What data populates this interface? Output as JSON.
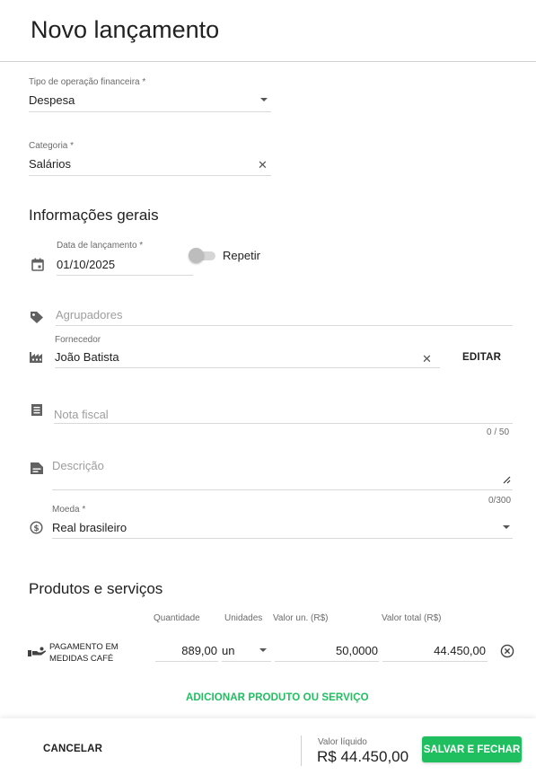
{
  "page": {
    "title": "Novo lançamento"
  },
  "operation": {
    "label": "Tipo de operação financeira *",
    "value": "Despesa"
  },
  "category": {
    "label": "Categoria *",
    "value": "Salários"
  },
  "general": {
    "heading": "Informações gerais",
    "date_label": "Data de lançamento *",
    "date_value": "01/10/2025",
    "repeat_label": "Repetir",
    "tags_placeholder": "Agrupadores",
    "supplier_label": "Fornecedor",
    "supplier_value": "João Batista",
    "edit_label": "EDITAR",
    "invoice_placeholder": "Nota fiscal",
    "invoice_counter": "0 / 50",
    "description_placeholder": "Descrição",
    "description_counter": "0/300",
    "currency_label": "Moeda *",
    "currency_value": "Real brasileiro"
  },
  "products": {
    "heading": "Produtos e serviços",
    "columns": {
      "quantity": "Quantidade",
      "units": "Unidades",
      "unit_value": "Valor un. (R$)",
      "total_value": "Valor total (R$)"
    },
    "rows": [
      {
        "name_line1": "PAGAMENTO EM",
        "name_line2": "MEDIDAS CAFÉ",
        "quantity": "889,00",
        "unit": "un",
        "unit_value": "50,0000",
        "total_value": "44.450,00"
      }
    ],
    "add_label": "ADICIONAR PRODUTO OU SERVIÇO"
  },
  "footer": {
    "cancel_label": "CANCELAR",
    "net_label": "Valor líquido",
    "net_value": "R$ 44.450,00",
    "save_label": "SALVAR E FECHAR"
  },
  "colors": {
    "accent": "#1fbf5f",
    "text": "#212121",
    "muted": "#6b6b6b"
  },
  "icons": [
    "calendar-icon",
    "tag-icon",
    "factory-icon",
    "receipt-icon",
    "description-icon",
    "currency-icon",
    "hand-coin-icon",
    "remove-circle-icon",
    "clear-icon",
    "dropdown-caret-icon",
    "resize-icon"
  ]
}
